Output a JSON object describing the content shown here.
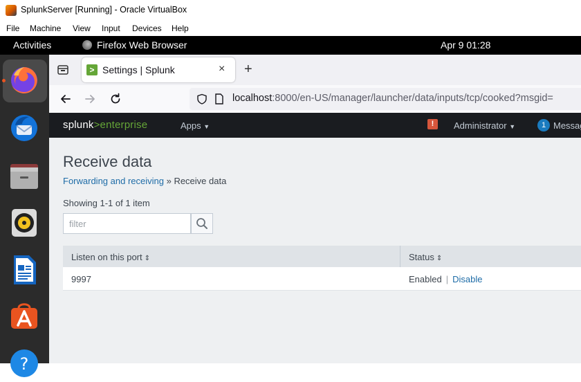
{
  "vbox": {
    "title": "SplunkServer [Running] - Oracle VirtualBox",
    "menu": [
      "File",
      "Machine",
      "View",
      "Input",
      "Devices",
      "Help"
    ]
  },
  "ubuntu": {
    "activities": "Activities",
    "app_name": "Firefox Web Browser",
    "clock": "Apr 9  01:28",
    "dock": [
      "firefox-icon",
      "thunderbird-icon",
      "files-icon",
      "rhythmbox-icon",
      "libreoffice-writer-icon",
      "app-center-icon",
      "help-icon"
    ]
  },
  "browser": {
    "tab_title": "Settings | Splunk",
    "tab_close": "×",
    "new_tab": "+",
    "url_host": "localhost",
    "url_path": ":8000/en-US/manager/launcher/data/inputs/tcp/cooked?msgid="
  },
  "splunk": {
    "logo_prefix": "splunk",
    "logo_gt": ">",
    "logo_suffix": "enterprise",
    "apps_label": "Apps",
    "alert_glyph": "!",
    "user_label": "Administrator",
    "messages_count": "1",
    "messages_label": "Messages"
  },
  "page": {
    "title": "Receive data",
    "breadcrumb_link": "Forwarding and receiving",
    "breadcrumb_sep": " » ",
    "breadcrumb_current": "Receive data",
    "showing": "Showing 1-1 of 1 item",
    "filter_placeholder": "filter",
    "columns": [
      "Listen on this port",
      "Status"
    ],
    "rows": [
      {
        "port": "9997",
        "status": "Enabled",
        "action": "Disable"
      }
    ]
  },
  "colors": {
    "splunk_green": "#65a637",
    "link_blue": "#1e6ca7",
    "alert_red": "#d6563c"
  }
}
